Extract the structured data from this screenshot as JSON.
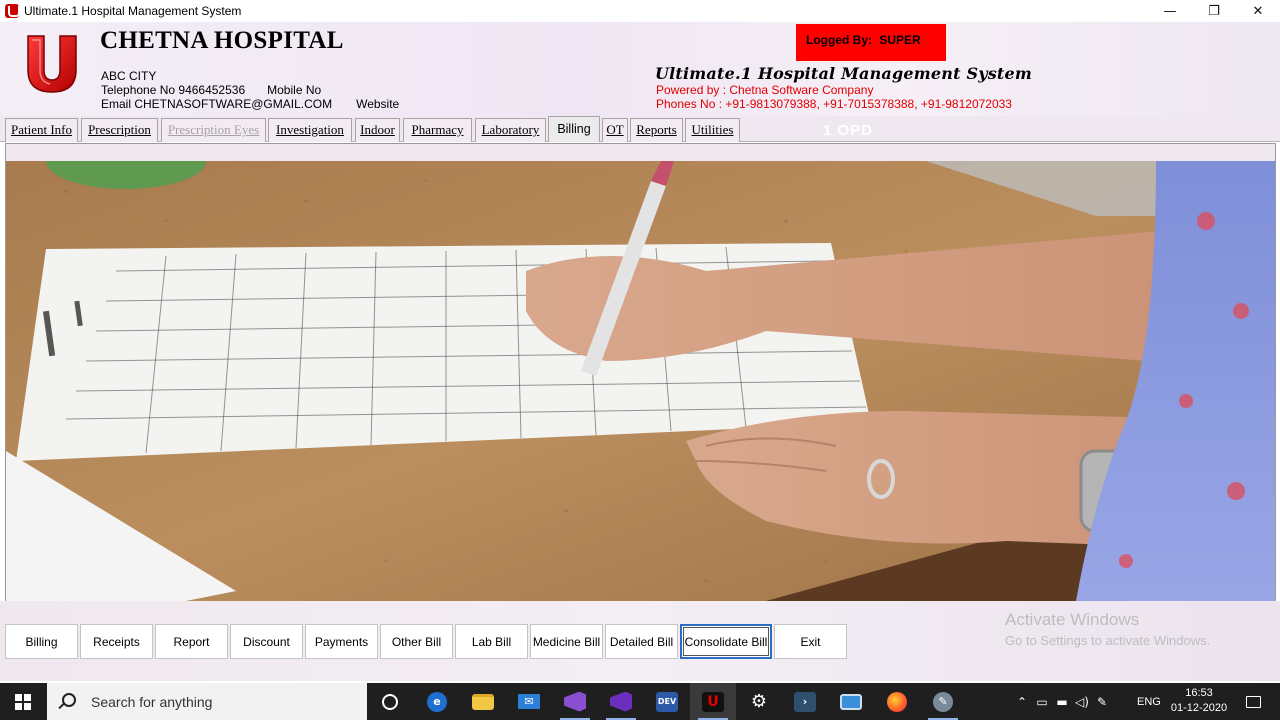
{
  "window": {
    "title": "Ultimate.1 Hospital Management System",
    "controls": [
      "—",
      "❐",
      "✕"
    ]
  },
  "header": {
    "hospital_name": "CHETNA HOSPITAL",
    "city": "ABC CITY",
    "telephone": "Telephone No 9466452536",
    "mobile": "Mobile No",
    "email": "Email CHETNASOFTWARE@GMAIL.COM",
    "website": "Website",
    "logged_by_label": "Logged By:",
    "logged_by_user": "SUPER",
    "product_name": "Ultimate.1 Hospital Management System",
    "powered_by": "Powered by : Chetna Software Company",
    "phones": "Phones No  : +91-9813079388, +91-7015378388, +91-9812072033",
    "logo_letter": "U",
    "logo_color": "#e10000"
  },
  "menu": {
    "tabs": [
      {
        "label": "Patient Info",
        "state": "normal"
      },
      {
        "label": "Prescription",
        "state": "normal"
      },
      {
        "label": "Prescription Eyes",
        "state": "disabled"
      },
      {
        "label": "Investigation",
        "state": "normal"
      },
      {
        "label": "Indoor",
        "state": "normal"
      },
      {
        "label": "Pharmacy",
        "state": "normal"
      },
      {
        "label": "Laboratory",
        "state": "normal"
      },
      {
        "label": "Billing",
        "state": "active"
      },
      {
        "label": "OT",
        "state": "normal"
      },
      {
        "label": "Reports",
        "state": "normal"
      },
      {
        "label": "Utilities",
        "state": "normal"
      }
    ],
    "opd_label": "1 OPD"
  },
  "billing_buttons": [
    {
      "label": "Billing"
    },
    {
      "label": "Receipts"
    },
    {
      "label": "Report"
    },
    {
      "label": "Discount"
    },
    {
      "label": "Payments"
    },
    {
      "label": "Other Bill"
    },
    {
      "label": "Lab Bill"
    },
    {
      "label": "Medicine Bill"
    },
    {
      "label": "Detailed Bill"
    },
    {
      "label": "Consolidate Bill",
      "focused": true
    },
    {
      "label": "Exit"
    }
  ],
  "watermark": {
    "line1": "Activate Windows",
    "line2": "Go to Settings to activate Windows."
  },
  "taskbar": {
    "search_placeholder": "Search for anything",
    "apps": [
      "task-view-icon",
      "edge-icon",
      "file-explorer-icon",
      "mail-icon",
      "visual-studio-icon",
      "visual-studio-2-icon",
      "devexpress-icon",
      "hospital-app-icon",
      "settings-icon",
      "powershell-icon",
      "remote-desktop-icon",
      "firefox-icon",
      "tools-icon"
    ],
    "tray": [
      "chevron-up-icon",
      "network-icon",
      "battery-icon",
      "volume-icon",
      "pen-icon"
    ],
    "language": "ENG",
    "time": "16:53",
    "date": "01-12-2020"
  },
  "colors": {
    "logged_bg": "#ff0000",
    "accent_red": "#e00000",
    "focus_blue": "#2b6cc4",
    "taskbar_bg": "#1f1f1f"
  }
}
